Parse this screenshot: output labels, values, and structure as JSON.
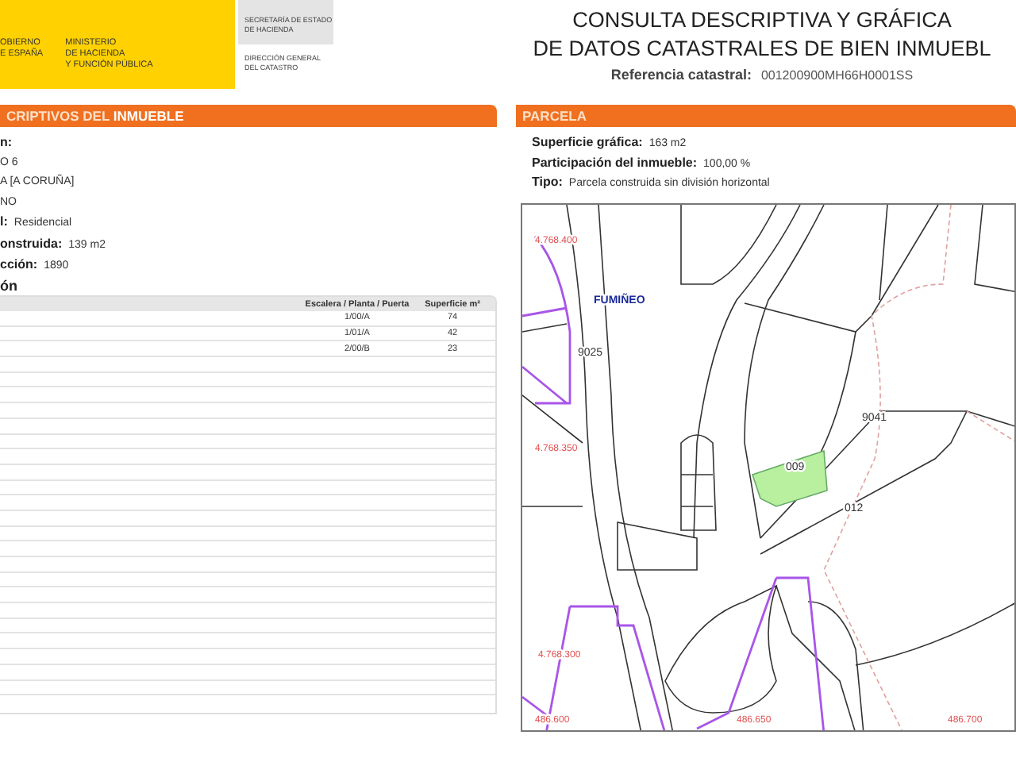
{
  "header": {
    "government": [
      "OBIERNO",
      "E ESPAÑA"
    ],
    "ministry": [
      "MINISTERIO",
      "DE HACIENDA",
      "Y FUNCIÓN PÚBLICA"
    ],
    "secretary": [
      "SECRETARÍA DE ESTADO",
      "DE HACIENDA"
    ],
    "directorate": [
      "DIRECCIÓN GENERAL",
      "DEL CATASTRO"
    ]
  },
  "title": [
    "CONSULTA DESCRIPTIVA Y GRÁFICA",
    "DE DATOS CATASTRALES DE BIEN INMUEBL"
  ],
  "reference": {
    "label": "Referencia catastral:",
    "value": "001200900MH66H0001SS"
  },
  "property_section": {
    "title": "CRIPTIVOS DEL **INMUEBLE**",
    "fields": [
      {
        "label": "n:"
      },
      {
        "value": "O 6"
      },
      {
        "value": "A [A CORUÑA]"
      },
      {
        "value": "NO"
      },
      {
        "label": "l:",
        "value": "Residencial"
      },
      {
        "label": "onstruida:",
        "value": "139 m2"
      },
      {
        "label": "cción:",
        "value": "1890"
      }
    ],
    "table_title": "ón",
    "table": {
      "columns": [
        "Escalera / Planta / Puerta",
        "Superficie m²"
      ],
      "rows": [
        {
          "door": "1/00/A",
          "area": "74"
        },
        {
          "door": "1/01/A",
          "area": "42"
        },
        {
          "door": "2/00/B",
          "area": "23"
        }
      ]
    }
  },
  "parcel_section": {
    "title": "PARCELA",
    "fields": [
      {
        "label": "Superficie gráfica:",
        "value": "163 m2"
      },
      {
        "label": "Participación del inmueble:",
        "value": "100,00 %"
      },
      {
        "label": "Tipo:",
        "value": "Parcela construida sin división horizontal"
      }
    ],
    "map": {
      "place_names": [
        "FUMIÑEO"
      ],
      "parcel_numbers": [
        "9025",
        "9041",
        "009",
        "012"
      ],
      "y_coordinates": [
        "4.768.400",
        "4.768.350",
        "4.768.300"
      ],
      "x_coordinates": [
        "486.600",
        "486.650",
        "486.700"
      ]
    }
  }
}
